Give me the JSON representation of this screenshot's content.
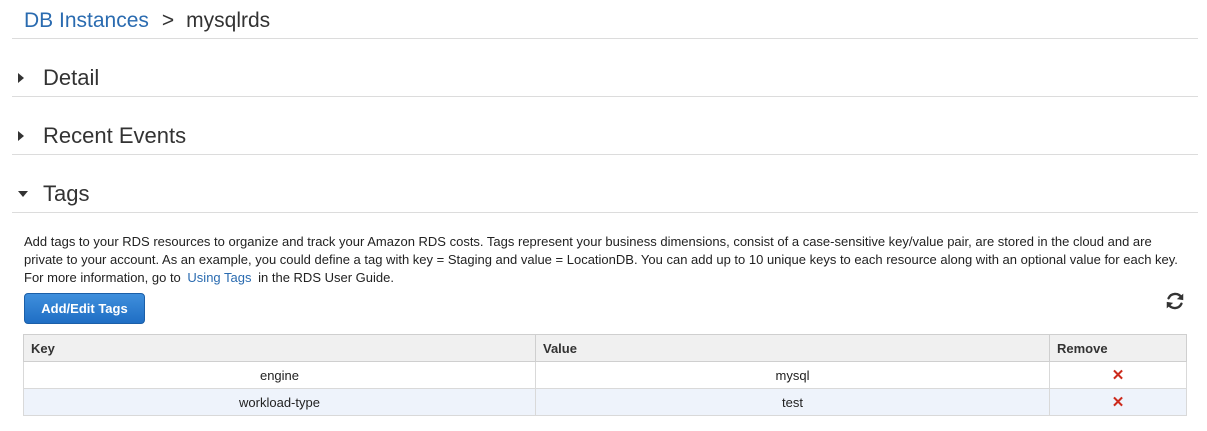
{
  "breadcrumb": {
    "parent": "DB Instances",
    "separator": ">",
    "current": "mysqlrds"
  },
  "sections": [
    {
      "title": "Detail",
      "expanded": false
    },
    {
      "title": "Recent Events",
      "expanded": false
    },
    {
      "title": "Tags",
      "expanded": true
    }
  ],
  "tags": {
    "description_before_link": "Add tags to your RDS resources to organize and track your Amazon RDS costs. Tags represent your business dimensions, consist of a case-sensitive key/value pair, are stored in the cloud and are private to your account. As an example, you could define a tag with key = Staging and value = LocationDB. You can add up to 10 unique keys to each resource along with an optional value for each key. For more information, go to",
    "link_text": "Using Tags",
    "description_after_link": "in the RDS User Guide.",
    "add_edit_button": "Add/Edit Tags",
    "refresh_icon": "refresh-icon",
    "columns": {
      "key": "Key",
      "value": "Value",
      "remove": "Remove"
    },
    "rows": [
      {
        "key": "engine",
        "value": "mysql",
        "remove": "✕"
      },
      {
        "key": "workload-type",
        "value": "test",
        "remove": "✕"
      }
    ]
  },
  "colors": {
    "link": "#2a6bb0",
    "button": "#1f6ec4",
    "remove": "#cc2a1c"
  }
}
